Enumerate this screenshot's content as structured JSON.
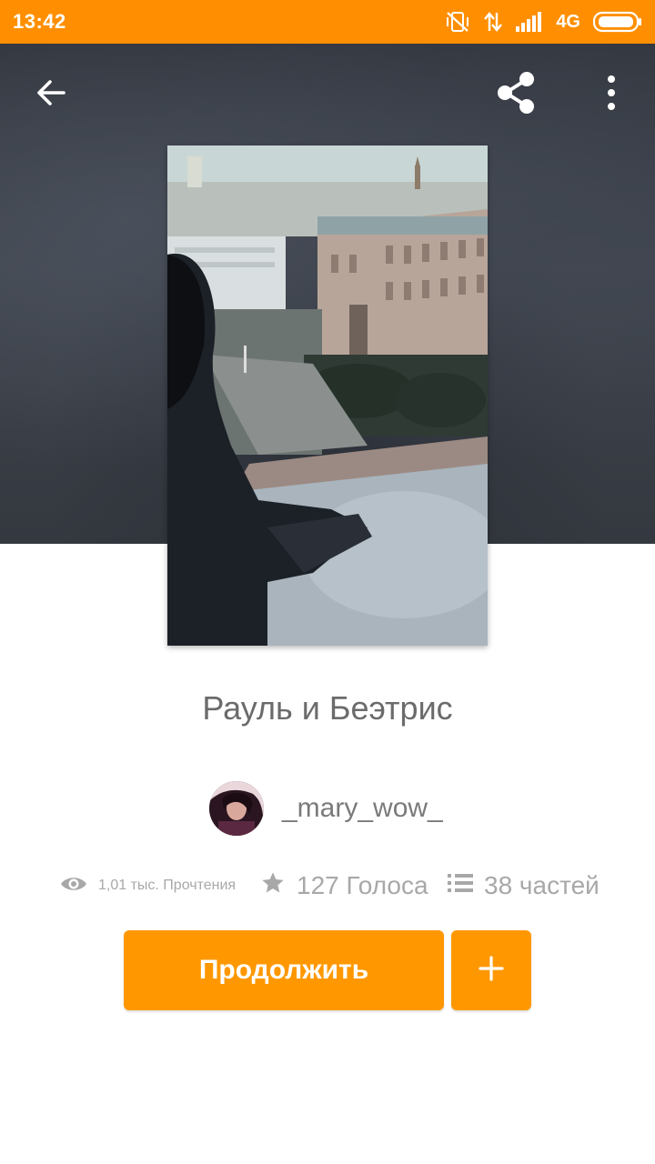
{
  "status_bar": {
    "time": "13:42",
    "network": "4G",
    "icons": [
      "vibrate-off-icon",
      "data-transfer-icon",
      "signal-icon",
      "battery-icon"
    ]
  },
  "toolbar": {
    "back_icon": "arrow-left-icon",
    "share_icon": "share-icon",
    "more_icon": "more-vertical-icon"
  },
  "story": {
    "cover_description": "cover-image",
    "title": "Рауль и Беэтрис",
    "author": "_mary_wow_"
  },
  "stats": {
    "reads": "1,01 тыс. Прочтения",
    "votes": "127 Голоса",
    "parts": "38 частей"
  },
  "actions": {
    "continue_label": "Продолжить",
    "add_icon": "plus-icon"
  },
  "colors": {
    "accent": "#ff9800",
    "status_bar": "#ff8f00",
    "text_secondary": "#a8a8a8"
  }
}
